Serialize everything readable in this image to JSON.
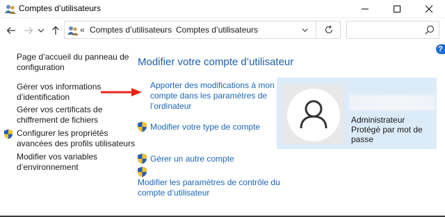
{
  "window": {
    "title": "Comptes d’utilisateurs",
    "app_icon": "user-accounts-icon",
    "buttons": [
      "minimize-icon",
      "maximize-icon",
      "close-icon"
    ]
  },
  "navbar": {
    "back_icon": "arrow-left-icon",
    "forward_icon": "arrow-right-icon",
    "recent_icon": "chevron-down-icon",
    "up_icon": "arrow-up-icon",
    "breadcrumb": {
      "separator": "«",
      "items": [
        "Comptes d’utilisateurs",
        "Comptes d’utilisateurs"
      ],
      "chevron": "›"
    },
    "search": {
      "placeholder": "",
      "value": ""
    }
  },
  "help": {
    "label": "?"
  },
  "left_pane": {
    "items": [
      {
        "lines": [
          "Page d’accueil du panneau de",
          "configuration"
        ],
        "shield": false
      },
      {
        "lines": [
          "Gérer vos informations",
          "d’identification"
        ],
        "shield": false
      },
      {
        "lines": [
          "Gérer vos certificats de",
          "chiffrement de fichiers"
        ],
        "shield": false
      },
      {
        "lines": [
          "Configurer les propriétés",
          "avancées des profils utilisateurs"
        ],
        "shield": true
      },
      {
        "lines": [
          "Modifier vos variables",
          "d’environnement"
        ],
        "shield": false
      }
    ]
  },
  "main": {
    "title": "Modifier votre compte d’utilisateur",
    "links": [
      {
        "lines": [
          "Apporter des modifications à mon",
          "compte dans les paramètres de",
          "l’ordinateur"
        ],
        "shield": false
      },
      {
        "lines": [
          "Modifier votre type de compte"
        ],
        "shield": true
      },
      {
        "lines": [
          "Gérer un autre compte"
        ],
        "shield": true
      },
      {
        "lines": [
          "Modifier les paramètres de contrôle du",
          "compte d’utilisateur"
        ],
        "shield": true
      }
    ]
  },
  "account": {
    "role": "Administrateur",
    "status": "Protégé par mot de passe",
    "avatar_icon": "user-silhouette-icon"
  },
  "colors": {
    "link": "#1a66b8",
    "title": "#1e5ea8",
    "panel": "#dcebf8",
    "arrow": "#e8231a"
  }
}
